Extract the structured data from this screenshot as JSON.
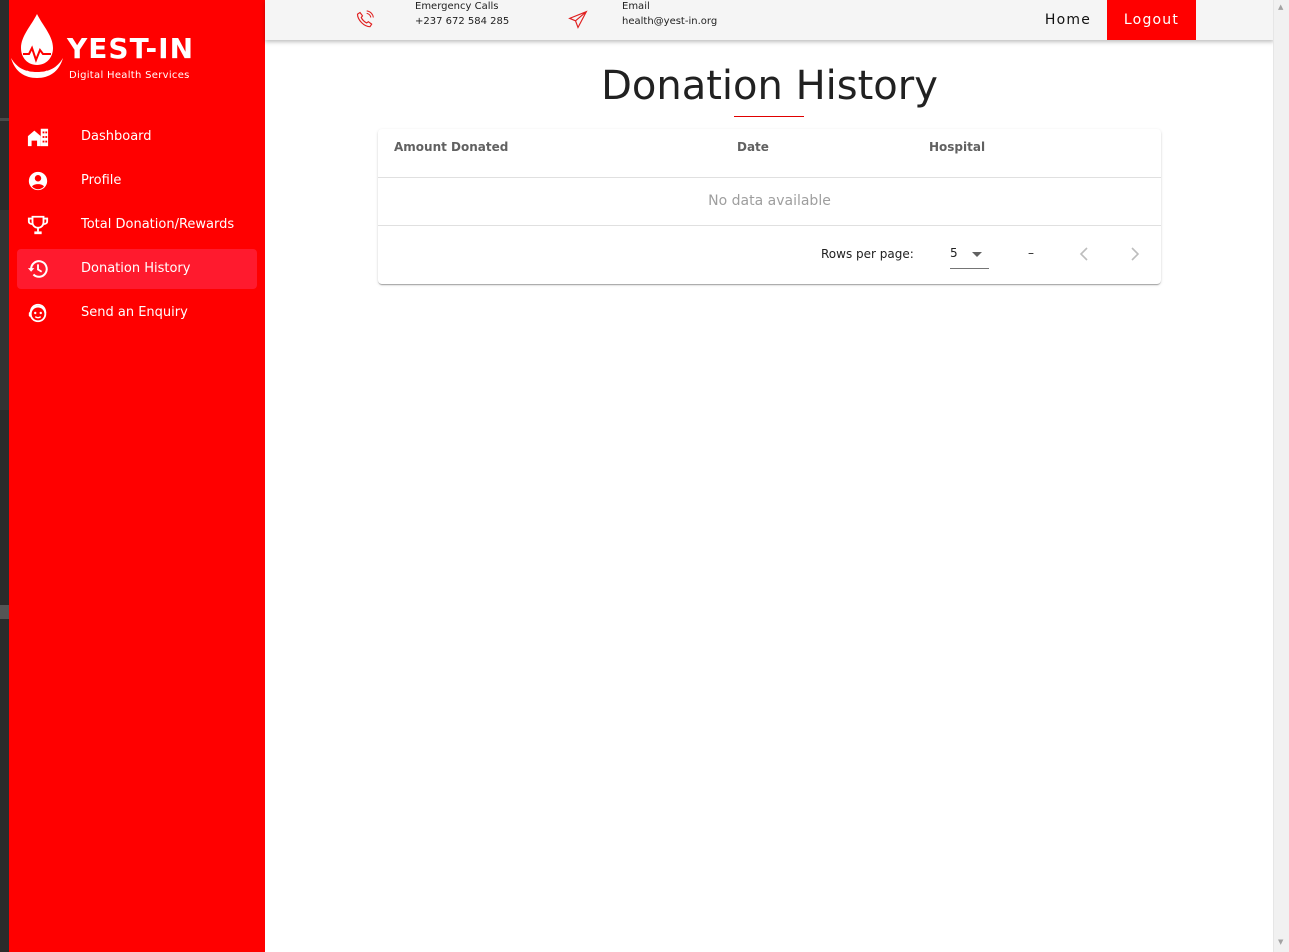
{
  "brand": {
    "name": "YEST-IN",
    "tagline": "Digital Health Services"
  },
  "sidebar": {
    "items": [
      {
        "label": "Dashboard",
        "icon": "building-icon",
        "active": false
      },
      {
        "label": "Profile",
        "icon": "account-circle-icon",
        "active": false
      },
      {
        "label": "Total Donation/Rewards",
        "icon": "trophy-icon",
        "active": false
      },
      {
        "label": "Donation History",
        "icon": "history-icon",
        "active": true
      },
      {
        "label": "Send an Enquiry",
        "icon": "face-agent-icon",
        "active": false
      }
    ]
  },
  "topbar": {
    "phone": {
      "title": "Emergency Calls",
      "value": "+237 672 584 285",
      "icon": "phone-ringing-icon"
    },
    "email": {
      "title": "Email",
      "value": "health@yest-in.org",
      "icon": "paper-plane-icon"
    },
    "home_label": "Home",
    "logout_label": "Logout"
  },
  "main": {
    "title": "Donation History",
    "table": {
      "columns": [
        "Amount Donated",
        "Date",
        "Hospital"
      ],
      "rows": [],
      "empty_text": "No data available",
      "footer": {
        "rows_per_page_label": "Rows per page:",
        "rows_per_page_value": "5",
        "range_text": "–"
      }
    }
  },
  "colors": {
    "brand_red": "#ff0000",
    "active_item": "#ff1a2e",
    "topbar_bg": "#f5f5f5"
  }
}
